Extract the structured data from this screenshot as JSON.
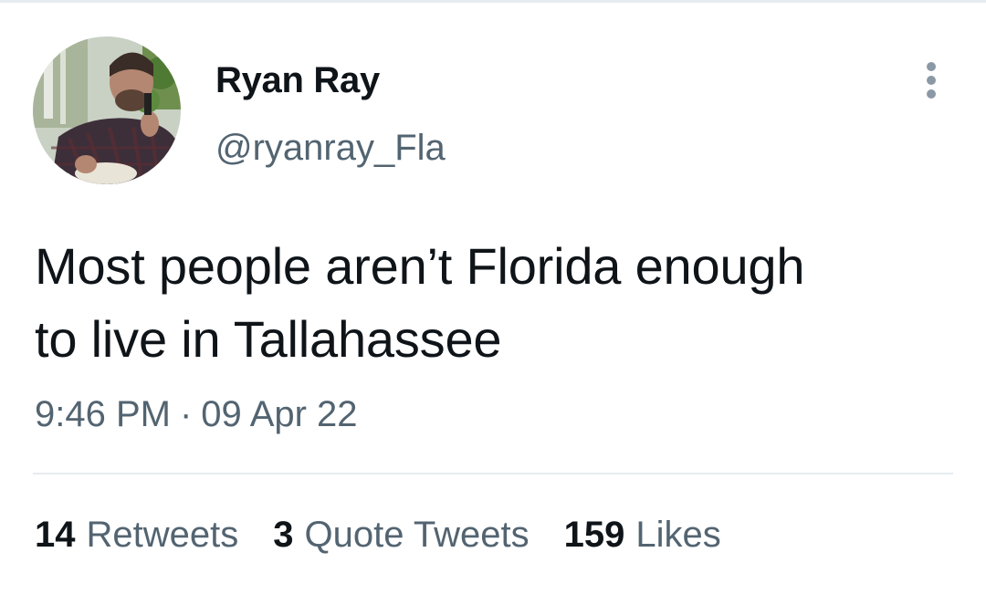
{
  "user": {
    "display_name": "Ryan Ray",
    "handle": "@ryanray_Fla"
  },
  "tweet": {
    "text_line1": "Most people aren’t Florida enough",
    "text_line2": "to live in Tallahassee",
    "time": "9:46 PM",
    "separator": "·",
    "date": "09 Apr 22"
  },
  "stats": [
    {
      "count": "14",
      "label": "Retweets"
    },
    {
      "count": "3",
      "label": "Quote Tweets"
    },
    {
      "count": "159",
      "label": "Likes"
    }
  ],
  "icons": {
    "more": "more-vertical-icon"
  },
  "colors": {
    "text_primary": "#0f1419",
    "text_secondary": "#536471",
    "divider": "#e6ecf0"
  }
}
